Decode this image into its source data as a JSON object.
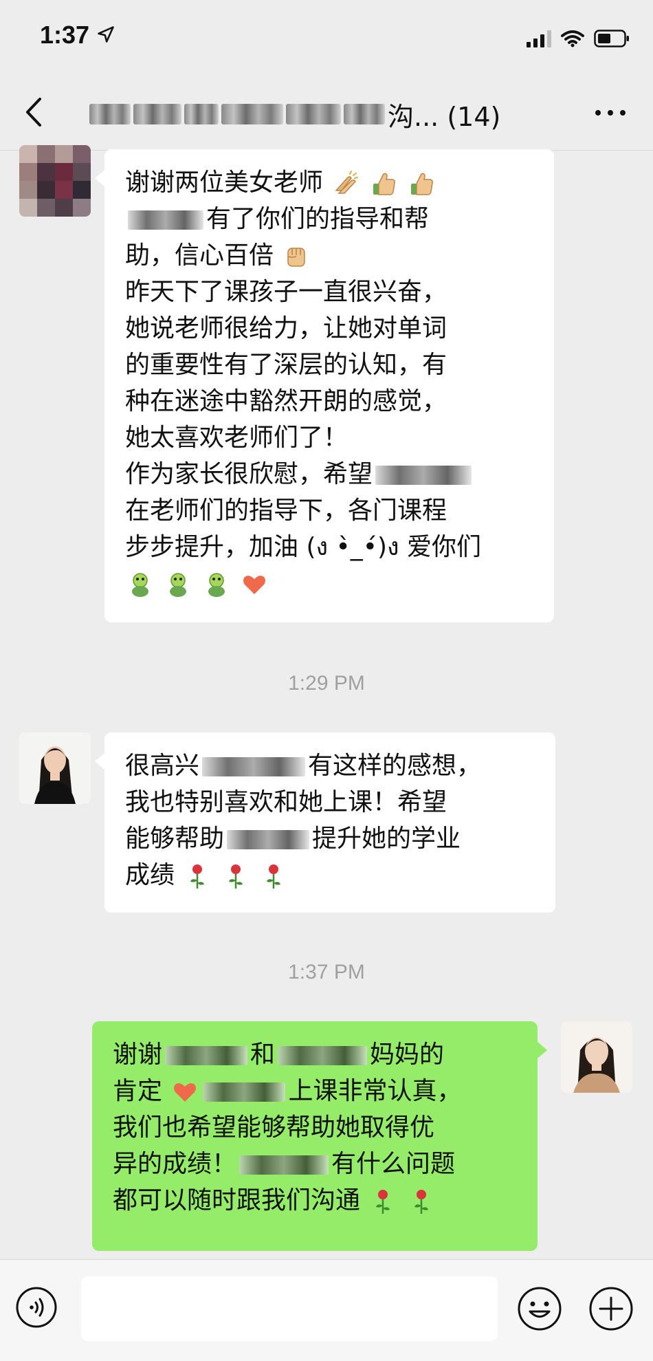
{
  "status_bar": {
    "time": "1:37"
  },
  "nav": {
    "title_suffix": "沟... (14)"
  },
  "messages": [
    {
      "side": "left",
      "lines": [
        "谢谢两位美女老师",
        "有了你们的指导和帮",
        "助，信心百倍",
        "昨天下了课孩子一直很兴奋，",
        "她说老师很给力，让她对单词",
        "的重要性有了深层的认知，有",
        "种在迷途中豁然开朗的感觉，",
        "她太喜欢老师们了！",
        "作为家长很欣慰，希望",
        "在老师们的指导下，各门课程",
        "步步提升，加油 (ง •̀_•́)ง 爱你们"
      ]
    },
    {
      "side": "left",
      "lines": [
        "很高兴",
        "有这样的感想，",
        "我也特别喜欢和她上课！希望",
        "能够帮助",
        "提升她的学业",
        "成绩"
      ]
    },
    {
      "side": "right",
      "lines": [
        "谢谢",
        "和",
        "妈妈的",
        "肯定",
        "上课非常认真，",
        "我们也希望能够帮助她取得优",
        "异的成绩！",
        "有什么问题",
        "都可以随时跟我们沟通"
      ]
    }
  ],
  "timestamps": [
    "1:29 PM",
    "1:37 PM"
  ],
  "input": {
    "placeholder": ""
  },
  "colors": {
    "background": "#ededed",
    "bubble_left": "#ffffff",
    "bubble_right": "#95ec69",
    "timestamp": "#a0a0a0"
  },
  "icons": [
    "location-arrow-icon",
    "signal-icon",
    "wifi-icon",
    "battery-icon",
    "back-chevron-icon",
    "more-icon",
    "voice-icon",
    "emoji-icon",
    "plus-icon",
    "clap-emoji",
    "thumbs-up-emoji",
    "fist-emoji",
    "frog-emoji",
    "heart-emoji",
    "rose-emoji"
  ]
}
